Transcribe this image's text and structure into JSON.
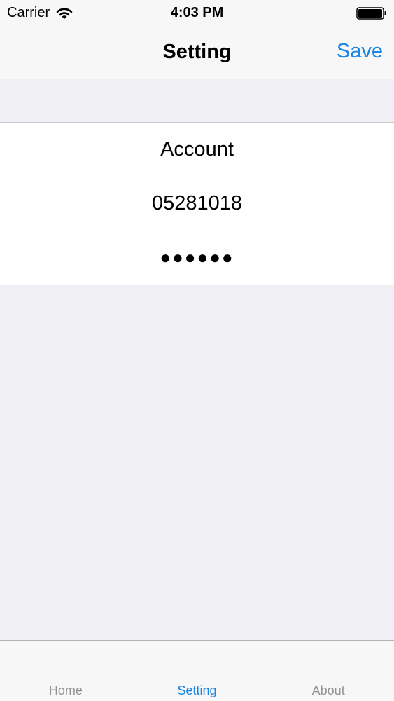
{
  "status_bar": {
    "carrier": "Carrier",
    "time": "4:03 PM",
    "wifi_icon": "wifi-icon",
    "battery_icon": "battery-icon"
  },
  "nav": {
    "title": "Setting",
    "save_label": "Save"
  },
  "form": {
    "account_label": "Account",
    "account_value": "05281018",
    "password_value": "●●●●●●"
  },
  "tabs": [
    {
      "label": "Home",
      "active": false
    },
    {
      "label": "Setting",
      "active": true
    },
    {
      "label": "About",
      "active": false
    }
  ],
  "colors": {
    "accent": "#1a84e5",
    "background": "#efeff4",
    "bar": "#f7f7f7",
    "inactive_tab": "#929292"
  }
}
